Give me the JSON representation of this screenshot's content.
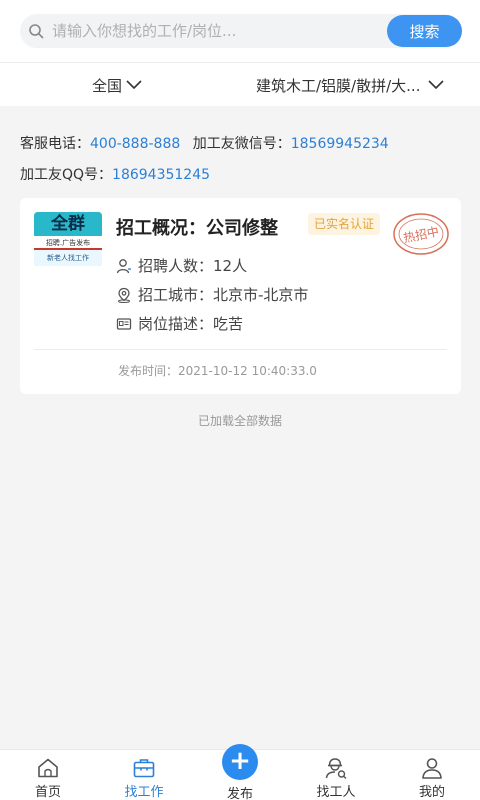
{
  "search": {
    "placeholder": "请输入你想找的工作/岗位...",
    "button_label": "搜索"
  },
  "filters": {
    "region": "全国",
    "category": "建筑木工/铝膜/散拼/大..."
  },
  "contact": {
    "phone_label": "客服电话：",
    "phone_value": "400-888-888",
    "wechat_label": "加工友微信号：",
    "wechat_value": "18569945234",
    "qq_label": "加工友QQ号：",
    "qq_value": "18694351245"
  },
  "job": {
    "logo_top": "全群",
    "logo_mid": "招聘.广告发布",
    "logo_bot": "新老人找工作",
    "title": "招工概况：公司修整",
    "verified": "已实名认证",
    "hot_stamp": "热招中",
    "count_text": "招聘人数：12人",
    "city_text": "招工城市：北京市-北京市",
    "desc_text": "岗位描述：吃苦",
    "publish_label": "发布时间：",
    "publish_value": "2021-10-12 10:40:33.0"
  },
  "list_status": "已加载全部数据",
  "nav": {
    "home": "首页",
    "jobs": "找工作",
    "post": "发布",
    "workers": "找工人",
    "mine": "我的"
  },
  "colors": {
    "accent": "#2c7fd6",
    "search_button": "#3d95f1",
    "badge_text": "#e5a43a",
    "stamp": "#d8705a"
  }
}
